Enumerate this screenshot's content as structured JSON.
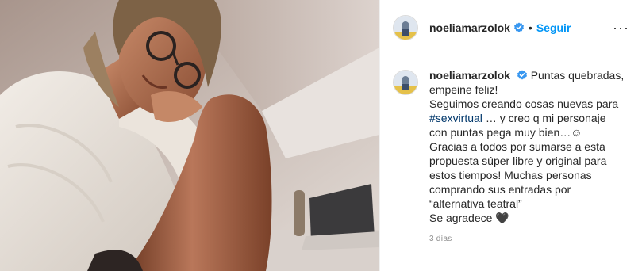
{
  "post": {
    "username": "noeliamarzolok",
    "verified_icon": "verified-badge-icon",
    "separator": "•",
    "follow_label": "Seguir",
    "more_icon": "more-options-icon",
    "more_glyph": "···",
    "caption_lines": [
      "Puntas quebradas,",
      "empeine feliz!",
      "Seguimos creando cosas nuevas para",
      "… y creo q mi personaje",
      "con puntas pega muy bien…☺",
      "Gracias a todos por sumarse a esta",
      "propuesta súper libre y original para",
      "estos tiempos! Muchas personas",
      "comprando sus entradas por",
      "“alternativa teatral”",
      "Se agradece 🖤"
    ],
    "hashtag": "#sexvirtual",
    "time_ago": "3 días"
  },
  "colors": {
    "link_blue": "#0095f6",
    "hashtag": "#00376b",
    "muted": "#8e8e8e",
    "text": "#262626"
  }
}
